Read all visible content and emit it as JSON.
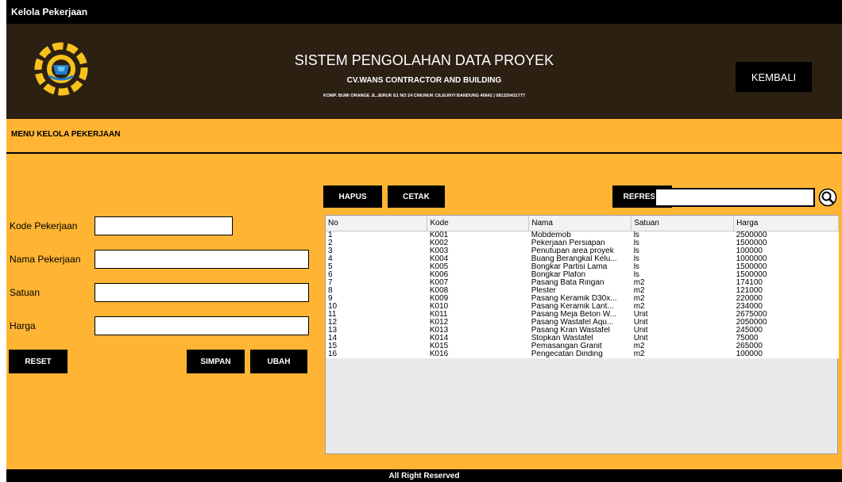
{
  "window": {
    "title": "Kelola Pekerjaan"
  },
  "header": {
    "title": "SISTEM PENGOLAHAN DATA PROYEK",
    "company": "CV.WANS CONTRACTOR AND BUILDING",
    "address": "KOMP. BUMI ORANGE JL.JERUK E1 NO 24 CINUNUK CILEUNYI BANDUNG 40642 | 081320431777",
    "back_label": "KEMBALI"
  },
  "menu": {
    "label": "MENU KELOLA PEKERJAAN"
  },
  "form": {
    "kode_label": "Kode Pekerjaan",
    "nama_label": "Nama Pekerjaan",
    "satuan_label": "Satuan",
    "harga_label": "Harga",
    "kode_value": "",
    "nama_value": "",
    "satuan_value": "",
    "harga_value": "",
    "reset_label": "RESET",
    "simpan_label": "SIMPAN",
    "ubah_label": "UBAH"
  },
  "toolbar": {
    "hapus_label": "HAPUS",
    "cetak_label": "CETAK",
    "refresh_label": "REFRESH",
    "search_value": ""
  },
  "table": {
    "headers": [
      "No",
      "Kode",
      "Nama",
      "Satuan",
      "Harga"
    ],
    "rows": [
      [
        "1",
        "K001",
        "Mobdemob",
        "ls",
        "2500000"
      ],
      [
        "2",
        "K002",
        "Pekerjaan Persiapan",
        "ls",
        "1500000"
      ],
      [
        "3",
        "K003",
        "Penutupan area proyek",
        "ls",
        "100000"
      ],
      [
        "4",
        "K004",
        "Buang Berangkal Kelu...",
        "ls",
        "1000000"
      ],
      [
        "5",
        "K005",
        "Bongkar Partisi Lama",
        "ls",
        "1500000"
      ],
      [
        "6",
        "K006",
        "Bongkar Plafon",
        "ls",
        "1500000"
      ],
      [
        "7",
        "K007",
        "Pasang Bata Ringan",
        "m2",
        "174100"
      ],
      [
        "8",
        "K008",
        "Plester",
        "m2",
        "121000"
      ],
      [
        "9",
        "K009",
        "Pasang Keramik D30x...",
        "m2",
        "220000"
      ],
      [
        "10",
        "K010",
        "Pasang Keramik Lant...",
        "m2",
        "234000"
      ],
      [
        "11",
        "K011",
        "Pasang Meja Beton W...",
        "Unit",
        "2675000"
      ],
      [
        "12",
        "K012",
        "Pasang Wastafel Aqu...",
        "Unit",
        "2050000"
      ],
      [
        "13",
        "K013",
        "Pasang Kran Wastafel",
        "Unit",
        "245000"
      ],
      [
        "14",
        "K014",
        "Stopkan Wastafel",
        "Unit",
        "75000"
      ],
      [
        "15",
        "K015",
        "Pemasangan Granit",
        "m2",
        "265000"
      ],
      [
        "16",
        "K016",
        "Pengecatan Dinding",
        "m2",
        "100000"
      ]
    ]
  },
  "footer": {
    "text": "All Right Reserved"
  },
  "colors": {
    "accent": "#FFB533",
    "header_bg": "#2C2013",
    "button_bg": "#000000"
  },
  "icons": {
    "logo": "gear-logo-icon",
    "search": "search-icon"
  }
}
